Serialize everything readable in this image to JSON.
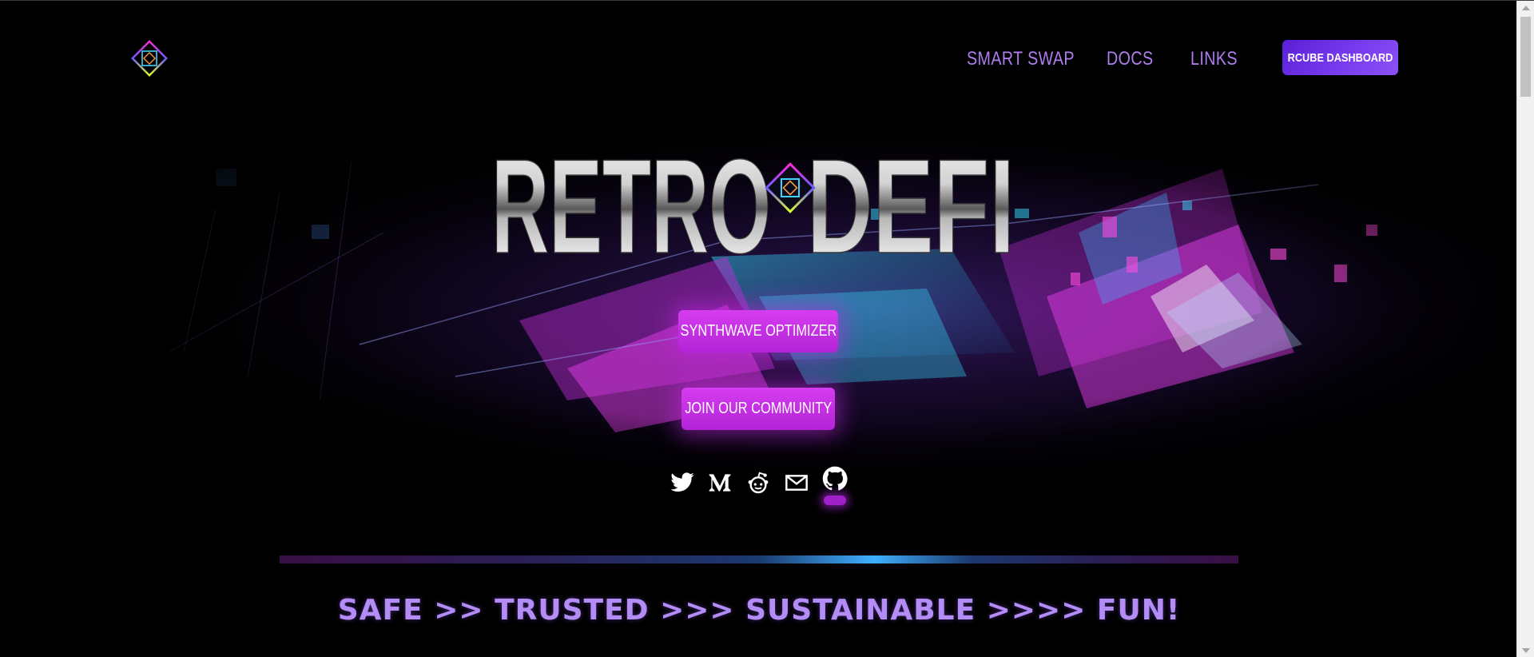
{
  "header": {
    "logo_icon": "retro-cube-logo",
    "nav": [
      {
        "label": "SMART SWAP"
      },
      {
        "label": "DOCS"
      },
      {
        "label": "LINKS"
      }
    ],
    "dashboard_button": "RCUBE DASHBOARD"
  },
  "hero": {
    "title_left": "RETRO",
    "title_right": "DEFI",
    "buttons": {
      "optimizer": "SYNTHWAVE OPTIMIZER",
      "community": "JOIN OUR COMMUNITY"
    },
    "socials": [
      "twitter-icon",
      "medium-icon",
      "reddit-icon",
      "mail-icon",
      "github-icon"
    ]
  },
  "tagline": "SAFE >> TRUSTED >>> SUSTAINABLE >>>> FUN!",
  "colors": {
    "accent_purple": "#b07cf0",
    "cta_magenta": "#c42ee0",
    "dashboard_violet": "#6a2ee6",
    "background": "#000000"
  }
}
